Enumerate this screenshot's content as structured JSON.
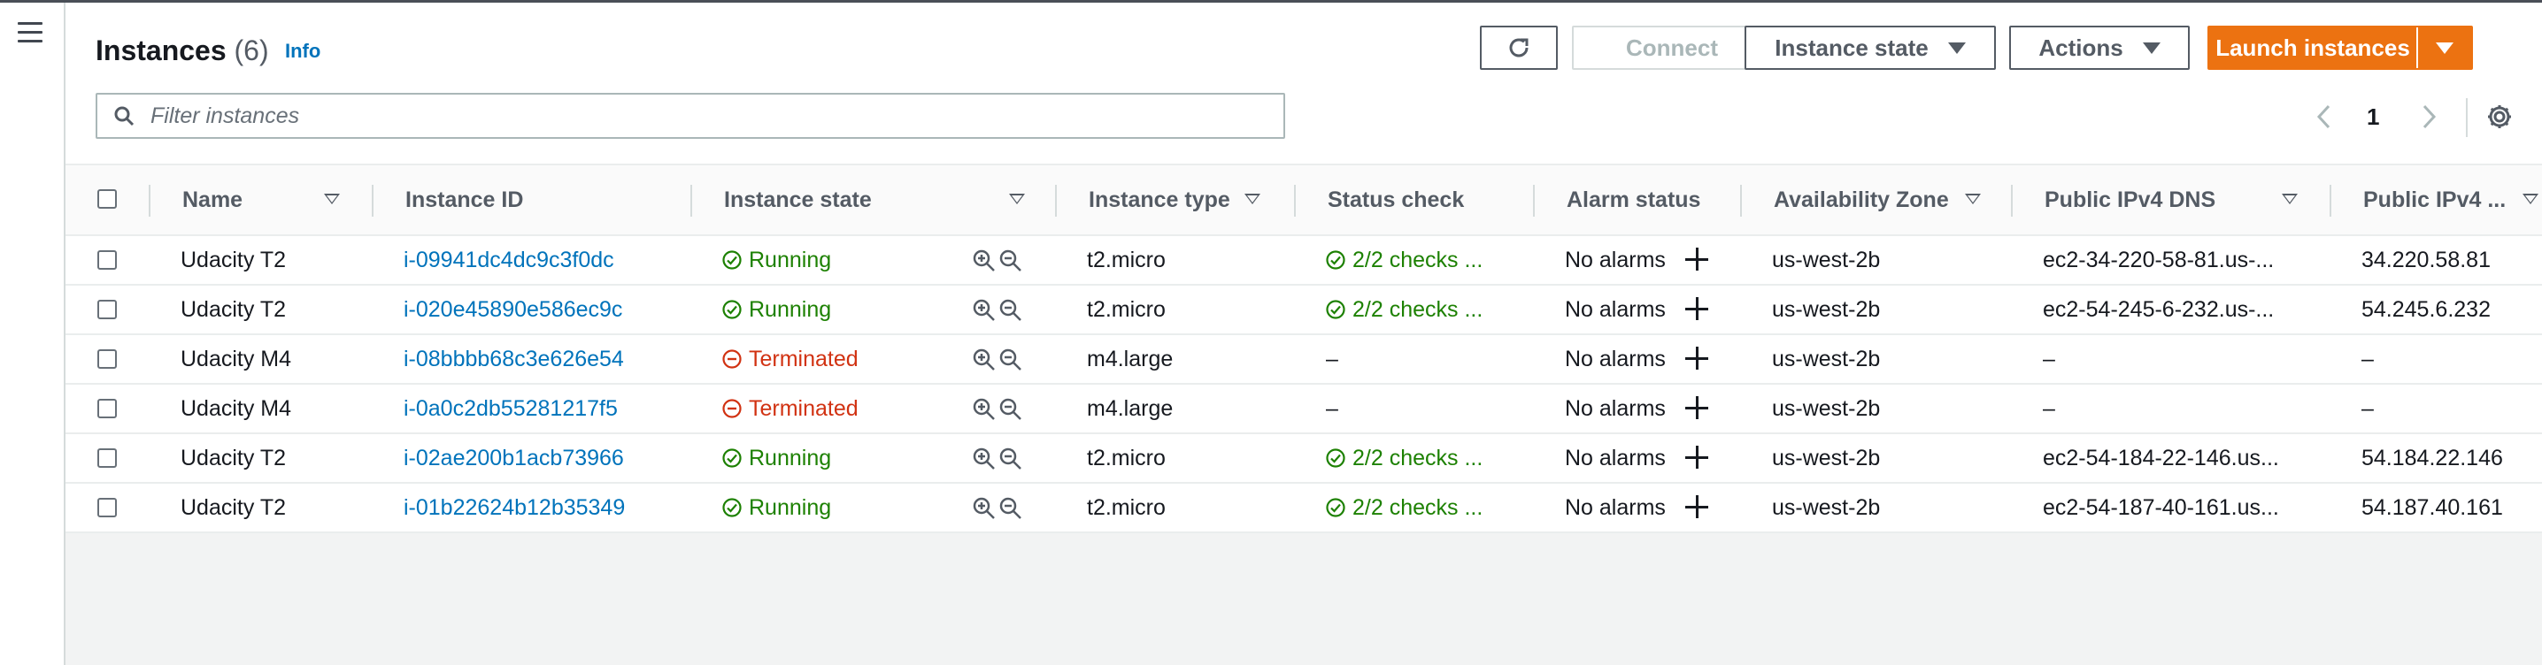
{
  "header": {
    "title": "Instances",
    "count": "(6)",
    "info": "Info"
  },
  "toolbar": {
    "refresh_icon": "refresh-icon",
    "connect": "Connect",
    "instance_state": "Instance state",
    "actions": "Actions",
    "launch": "Launch instances"
  },
  "search": {
    "placeholder": "Filter instances"
  },
  "pagination": {
    "page": "1"
  },
  "columns": {
    "name": "Name",
    "instance_id": "Instance ID",
    "instance_state": "Instance state",
    "instance_type": "Instance type",
    "status_check": "Status check",
    "alarm_status": "Alarm status",
    "availability_zone": "Availability Zone",
    "public_dns": "Public IPv4 DNS",
    "public_ip": "Public IPv4 ..."
  },
  "rows": [
    {
      "name": "Udacity T2",
      "id": "i-09941dc4dc9c3f0dc",
      "state": "Running",
      "type": "t2.micro",
      "status": "2/2 checks ...",
      "alarm": "No alarms",
      "az": "us-west-2b",
      "dns": "ec2-34-220-58-81.us-...",
      "ip": "34.220.58.81"
    },
    {
      "name": "Udacity T2",
      "id": "i-020e45890e586ec9c",
      "state": "Running",
      "type": "t2.micro",
      "status": "2/2 checks ...",
      "alarm": "No alarms",
      "az": "us-west-2b",
      "dns": "ec2-54-245-6-232.us-...",
      "ip": "54.245.6.232"
    },
    {
      "name": "Udacity M4",
      "id": "i-08bbbb68c3e626e54",
      "state": "Terminated",
      "type": "m4.large",
      "status": "–",
      "alarm": "No alarms",
      "az": "us-west-2b",
      "dns": "–",
      "ip": "–"
    },
    {
      "name": "Udacity M4",
      "id": "i-0a0c2db55281217f5",
      "state": "Terminated",
      "type": "m4.large",
      "status": "–",
      "alarm": "No alarms",
      "az": "us-west-2b",
      "dns": "–",
      "ip": "–"
    },
    {
      "name": "Udacity T2",
      "id": "i-02ae200b1acb73966",
      "state": "Running",
      "type": "t2.micro",
      "status": "2/2 checks ...",
      "alarm": "No alarms",
      "az": "us-west-2b",
      "dns": "ec2-54-184-22-146.us...",
      "ip": "54.184.22.146"
    },
    {
      "name": "Udacity T2",
      "id": "i-01b22624b12b35349",
      "state": "Running",
      "type": "t2.micro",
      "status": "2/2 checks ...",
      "alarm": "No alarms",
      "az": "us-west-2b",
      "dns": "ec2-54-187-40-161.us...",
      "ip": "54.187.40.161"
    }
  ],
  "colors": {
    "accent": "#ec7211",
    "link": "#0073bb",
    "running": "#1d8102",
    "terminated": "#d13212"
  }
}
